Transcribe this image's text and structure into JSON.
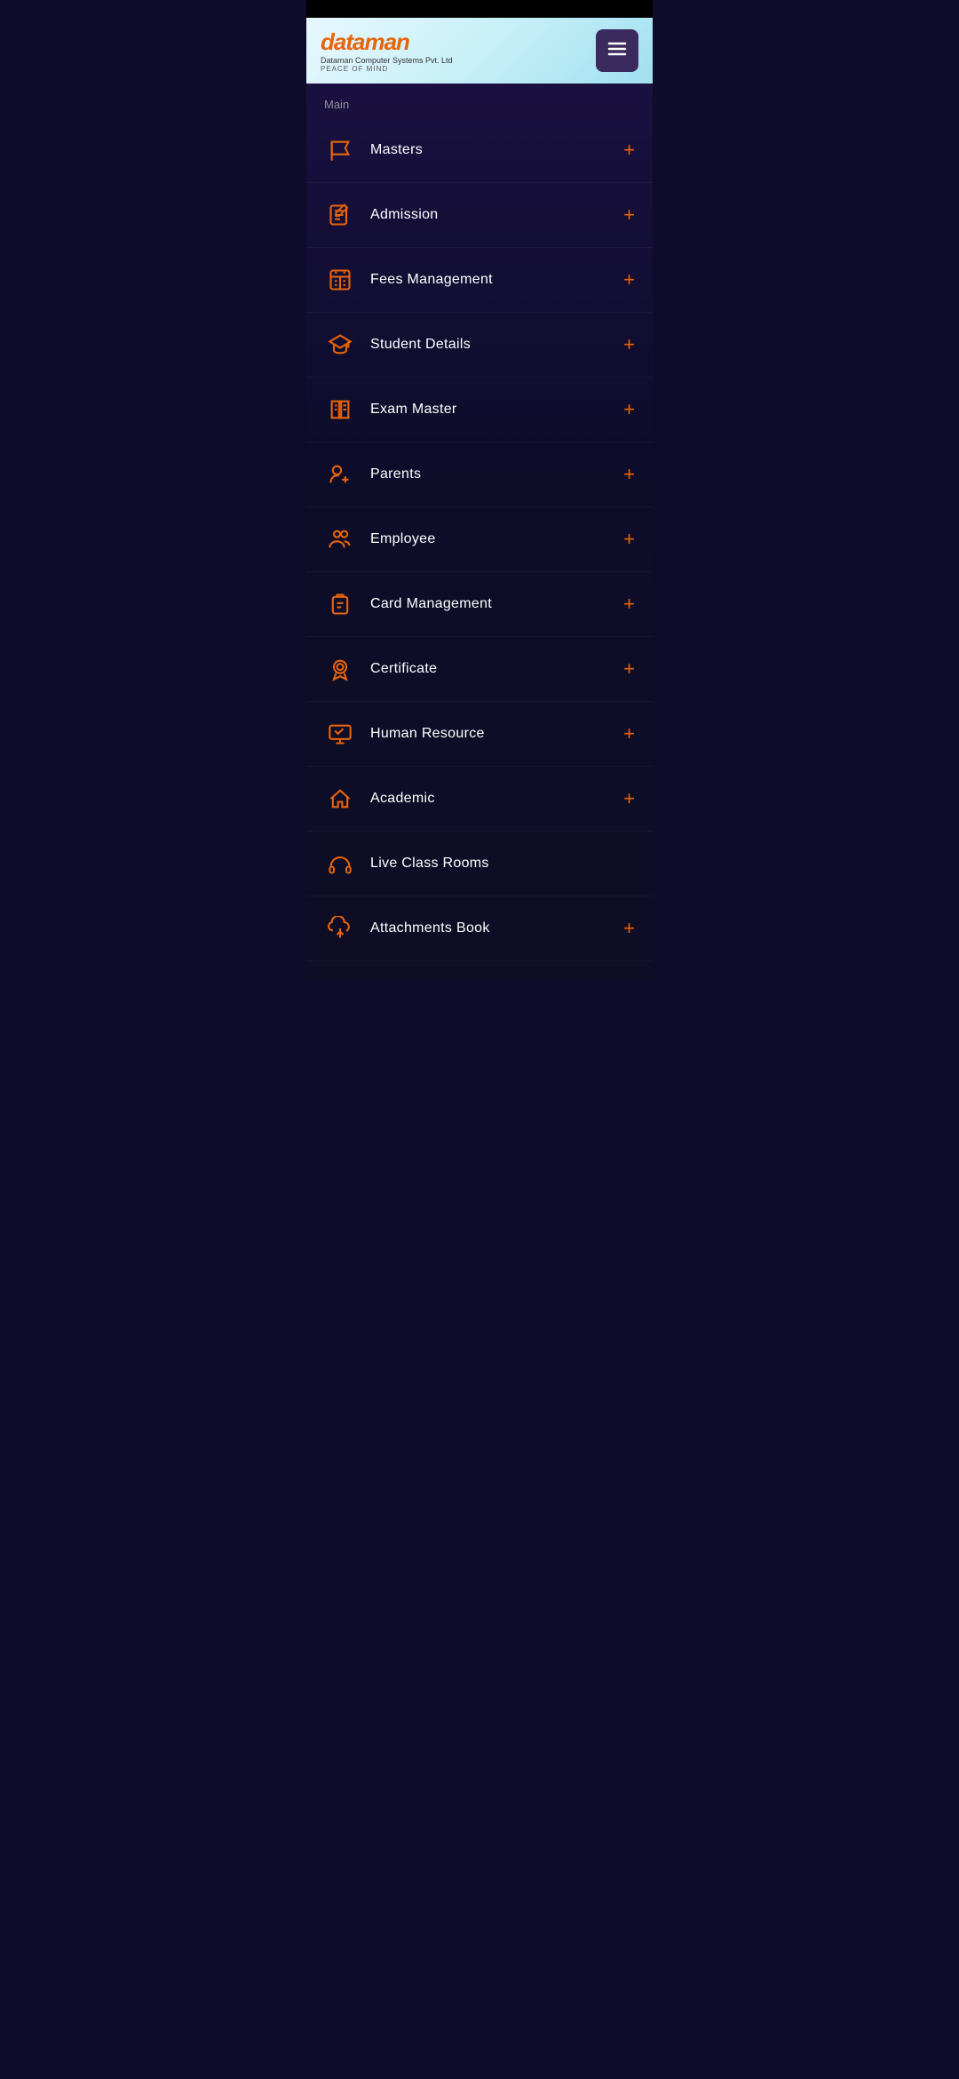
{
  "header": {
    "logo_main": "dataman",
    "logo_subtitle": "Dataman Computer Systems Pvt. Ltd",
    "logo_tagline": "PEACE OF MIND",
    "menu_button_label": "☰"
  },
  "sidebar": {
    "section_label": "Main",
    "items": [
      {
        "id": "masters",
        "label": "Masters",
        "icon": "flag",
        "has_plus": true
      },
      {
        "id": "admission",
        "label": "Admission",
        "icon": "edit",
        "has_plus": true
      },
      {
        "id": "fees-management",
        "label": "Fees Management",
        "icon": "calculator",
        "has_plus": true
      },
      {
        "id": "student-details",
        "label": "Student Details",
        "icon": "graduation",
        "has_plus": true
      },
      {
        "id": "exam-master",
        "label": "Exam Master",
        "icon": "book",
        "has_plus": true
      },
      {
        "id": "parents",
        "label": "Parents",
        "icon": "person-add",
        "has_plus": true
      },
      {
        "id": "employee",
        "label": "Employee",
        "icon": "people",
        "has_plus": true
      },
      {
        "id": "card-management",
        "label": "Card Management",
        "icon": "clipboard",
        "has_plus": true
      },
      {
        "id": "certificate",
        "label": "Certificate",
        "icon": "badge",
        "has_plus": true
      },
      {
        "id": "human-resource",
        "label": "Human Resource",
        "icon": "monitor",
        "has_plus": true
      },
      {
        "id": "academic",
        "label": "Academic",
        "icon": "home",
        "has_plus": true
      },
      {
        "id": "live-class-rooms",
        "label": "Live Class Rooms",
        "icon": "headphones",
        "has_plus": false
      },
      {
        "id": "attachments-book",
        "label": "Attachments Book",
        "icon": "cloud-upload",
        "has_plus": true
      }
    ]
  }
}
